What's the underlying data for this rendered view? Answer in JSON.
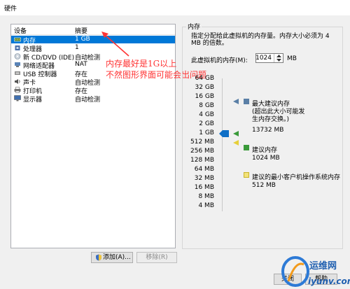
{
  "window": {
    "title": "硬件"
  },
  "device_list": {
    "headers": {
      "device": "设备",
      "summary": "摘要"
    },
    "rows": [
      {
        "device": "内存",
        "summary": "1 GB",
        "icon": "memory-icon",
        "selected": true
      },
      {
        "device": "处理器",
        "summary": "1",
        "icon": "cpu-icon"
      },
      {
        "device": "新 CD/DVD (IDE)",
        "summary": "自动检测",
        "icon": "cd-icon"
      },
      {
        "device": "网络适配器",
        "summary": "NAT",
        "icon": "network-icon"
      },
      {
        "device": "USB 控制器",
        "summary": "存在",
        "icon": "usb-icon"
      },
      {
        "device": "声卡",
        "summary": "自动检测",
        "icon": "sound-icon"
      },
      {
        "device": "打印机",
        "summary": "存在",
        "icon": "printer-icon"
      },
      {
        "device": "显示器",
        "summary": "自动检测",
        "icon": "display-icon"
      }
    ]
  },
  "annotation": {
    "line1": "内存最好是1G以上",
    "line2": "不然图形界面可能会出问题",
    "color": "#ff3333"
  },
  "buttons": {
    "add": "添加(A)...",
    "remove": "移除(R)",
    "close": "关闭",
    "help": "帮助"
  },
  "memory": {
    "group_title": "内存",
    "description": "指定分配给此虚拟机的内存量。内存大小必须为 4 MB 的倍数。",
    "field_label": "此虚拟机的内存(M):",
    "value": "1024",
    "unit": "MB",
    "scale": [
      "64 GB",
      "32 GB",
      "16 GB",
      "8 GB",
      "4 GB",
      "2 GB",
      "1 GB",
      "512 MB",
      "256 MB",
      "128 MB",
      "64 MB",
      "32 MB",
      "16 MB",
      "8 MB",
      "4 MB"
    ],
    "current_level": "1 GB",
    "legend": {
      "max": {
        "title": "最大建议内存",
        "note": "(超出此大小可能发生内存交换。)",
        "value": "13732 MB",
        "color": "#5a7fa6"
      },
      "recommended": {
        "title": "建议内存",
        "value": "1024 MB",
        "color": "#3a9a3a"
      },
      "min_guest": {
        "title": "建议的最小客户机操作系统内存",
        "value": "512 MB",
        "color": "#e6cf3a"
      }
    }
  },
  "watermark": {
    "text": "运维网",
    "url_text": "iyunv.com"
  }
}
